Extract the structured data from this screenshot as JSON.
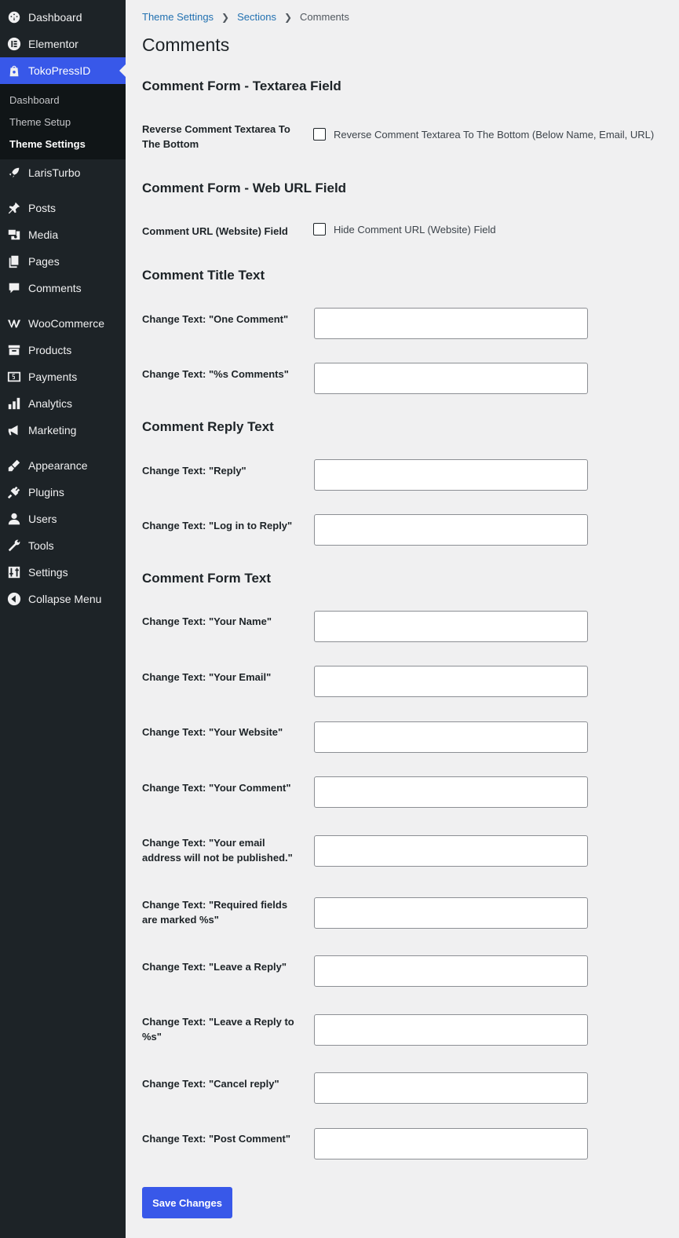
{
  "sidebar": {
    "items": [
      {
        "label": "Dashboard",
        "icon": "dashboard-icon"
      },
      {
        "label": "Elementor",
        "icon": "elementor-icon"
      },
      {
        "label": "TokoPressID",
        "icon": "shopping-bag-icon"
      },
      {
        "label": "LarisTurbo",
        "icon": "rocket-icon"
      },
      {
        "label": "Posts",
        "icon": "pin-icon"
      },
      {
        "label": "Media",
        "icon": "media-icon"
      },
      {
        "label": "Pages",
        "icon": "pages-icon"
      },
      {
        "label": "Comments",
        "icon": "comment-icon"
      },
      {
        "label": "WooCommerce",
        "icon": "woocommerce-icon"
      },
      {
        "label": "Products",
        "icon": "archive-icon"
      },
      {
        "label": "Payments",
        "icon": "payment-icon"
      },
      {
        "label": "Analytics",
        "icon": "bar-chart-icon"
      },
      {
        "label": "Marketing",
        "icon": "megaphone-icon"
      },
      {
        "label": "Appearance",
        "icon": "paintbrush-icon"
      },
      {
        "label": "Plugins",
        "icon": "plugin-icon"
      },
      {
        "label": "Users",
        "icon": "user-icon"
      },
      {
        "label": "Tools",
        "icon": "wrench-icon"
      },
      {
        "label": "Settings",
        "icon": "settings-icon"
      },
      {
        "label": "Collapse Menu",
        "icon": "collapse-icon"
      }
    ],
    "submenu": [
      "Dashboard",
      "Theme Setup",
      "Theme Settings"
    ],
    "accent": "#3858e9"
  },
  "breadcrumb": {
    "items": [
      "Theme Settings",
      "Sections"
    ],
    "current": "Comments"
  },
  "page_title": "Comments",
  "sections": {
    "textarea": {
      "title": "Comment Form - Textarea Field",
      "row_label": "Reverse Comment Textarea To The Bottom",
      "checkbox_label": "Reverse Comment Textarea To The Bottom (Below Name, Email, URL)"
    },
    "weburl": {
      "title": "Comment Form - Web URL Field",
      "row_label": "Comment URL (Website) Field",
      "checkbox_label": "Hide Comment URL (Website) Field"
    },
    "title_text": {
      "title": "Comment Title Text",
      "rows": [
        "Change Text: \"One Comment\"",
        "Change Text: \"%s Comments\""
      ]
    },
    "reply_text": {
      "title": "Comment Reply Text",
      "rows": [
        "Change Text: \"Reply\"",
        "Change Text: \"Log in to Reply\""
      ]
    },
    "form_text": {
      "title": "Comment Form Text",
      "rows": [
        "Change Text: \"Your Name\"",
        "Change Text: \"Your Email\"",
        "Change Text: \"Your Website\"",
        "Change Text: \"Your Comment\"",
        "Change Text: \"Your email address will not be published.\"",
        "Change Text: \"Required fields are marked %s\"",
        "Change Text: \"Leave a Reply\"",
        "Change Text: \"Leave a Reply to %s\"",
        "Change Text: \"Cancel reply\"",
        "Change Text: \"Post Comment\""
      ]
    }
  },
  "save_label": "Save Changes"
}
